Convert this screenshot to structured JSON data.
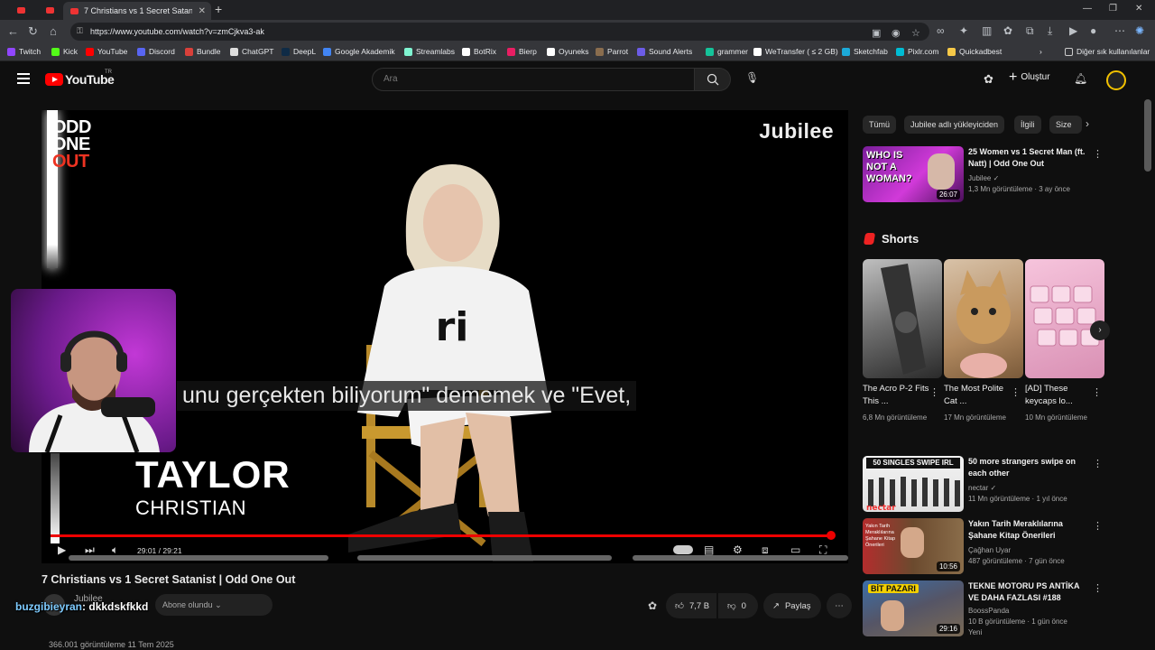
{
  "browser": {
    "active_tab_title": "7 Christians vs 1 Secret Satanist | Odd",
    "url": "https://www.youtube.com/watch?v=zmCjkva3-ak",
    "bookmarks": [
      {
        "label": "Twitch",
        "color": "#9146ff"
      },
      {
        "label": "Kick",
        "color": "#53fc18"
      },
      {
        "label": "YouTube",
        "color": "#ff0000"
      },
      {
        "label": "Discord",
        "color": "#5865f2"
      },
      {
        "label": "Bundle",
        "color": "#d9403a"
      },
      {
        "label": "ChatGPT",
        "color": "#dddddd"
      },
      {
        "label": "DeepL",
        "color": "#0f2b46"
      },
      {
        "label": "Google Akademik",
        "color": "#4285f4"
      },
      {
        "label": "Streamlabs",
        "color": "#80f5d2"
      },
      {
        "label": "BotRix",
        "color": "#ffffff"
      },
      {
        "label": "Bierp",
        "color": "#e91e63"
      },
      {
        "label": "Oyuneks",
        "color": "#ffffff"
      },
      {
        "label": "Parrot",
        "color": "#8a6d4e"
      },
      {
        "label": "Sound Alerts",
        "color": "#6c5ce7"
      },
      {
        "label": "grammer",
        "color": "#15c39a"
      },
      {
        "label": "WeTransfer ( ≤ 2 GB)",
        "color": "#ffffff"
      },
      {
        "label": "Sketchfab",
        "color": "#1caad9"
      },
      {
        "label": "Pixlr.com",
        "color": "#00bcd4"
      },
      {
        "label": "Quickadbest",
        "color": "#f7c948"
      }
    ],
    "other_bookmarks": "Diğer sık kullanılanlar"
  },
  "header": {
    "logo_text": "YouTube",
    "country_code": "TR",
    "search_placeholder": "Ara",
    "create_label": "Oluştur"
  },
  "player": {
    "overlay_logo_lines": [
      "ODD",
      "ONE",
      "OUT"
    ],
    "watermark": "Jubilee",
    "subtitle": "unu gerçekten biliyorum\" dememek ve \"Evet,",
    "lower_third_name": "TAYLOR",
    "lower_third_role": "CHRISTIAN",
    "time": "29:01 / 29:21",
    "progress_fraction": 0.99
  },
  "video": {
    "title": "7 Christians vs 1 Secret Satanist | Odd One Out",
    "channel": "Jubilee",
    "subscribed_label": "Abone olundu",
    "likes": "7,7 B",
    "dislikes": "0",
    "share_label": "Paylaş",
    "views_line": "366.001 görüntüleme  11 Tem 2025"
  },
  "chat_overlay": {
    "user": "buzgibieyran",
    "separator": ": ",
    "message": "dkkdskfkkd"
  },
  "sidebar": {
    "chips": [
      "Tümü",
      "Jubilee adlı yükleyiciden",
      "İlgili",
      "Size"
    ],
    "top_video": {
      "title": "25 Women vs 1 Secret Man (ft. Natt) | Odd One Out",
      "channel": "Jubilee",
      "meta": "1,3 Mn görüntüleme · 3 ay önce",
      "duration": "26:07",
      "thumb_text": "WHO IS NOT A WOMAN?"
    },
    "shorts_title": "Shorts",
    "shorts": [
      {
        "title": "The Acro P-2 Fits This ...",
        "views": "6,8 Mn görüntüleme"
      },
      {
        "title": "The Most Polite Cat ...",
        "views": "17 Mn görüntüleme"
      },
      {
        "title": "[AD] These keycaps lo...",
        "views": "10 Mn görüntüleme"
      }
    ],
    "videos": [
      {
        "title": "50 more strangers swipe on each other",
        "channel": "nectar",
        "meta": "11 Mn görüntüleme · 1 yıl önce",
        "thumb_text": "50 SINGLES SWIPE IRL",
        "duration": ""
      },
      {
        "title": "Yakın Tarih Meraklılarına Şahane Kitap Önerileri",
        "channel": "Çağhan Uyar",
        "meta": "487 görüntüleme · 7 gün önce",
        "thumb_text": "Yakın Tarih Meraklılarına Şahane Kitap Önerileri",
        "duration": "10:56"
      },
      {
        "title": "TEKNE MOTORU PS ANTİKA VE DAHA FAZLASI #188",
        "channel": "BoossPanda",
        "meta": "10 B görüntüleme · 1 gün önce",
        "badge": "Yeni",
        "thumb_text": "BİT PAZARI",
        "duration": "29:16"
      }
    ]
  }
}
